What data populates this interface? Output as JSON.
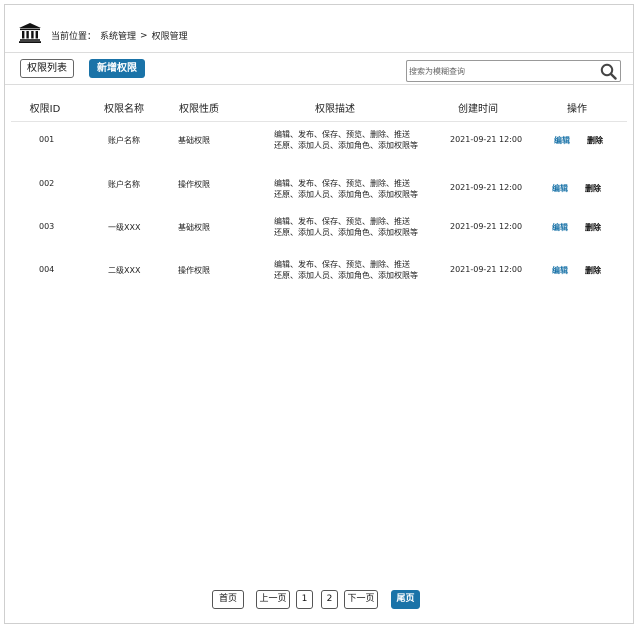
{
  "breadcrumb": {
    "prefix": "当前位置：",
    "section": "系统管理",
    "separator": ">",
    "current": "权限管理"
  },
  "toolbar": {
    "list_tab_label": "权限列表",
    "add_button_label": "新增权限",
    "search_placeholder": "搜索为模糊查询"
  },
  "table": {
    "headers": [
      "权限ID",
      "权限名称",
      "权限性质",
      "权限描述",
      "创建时间",
      "操作"
    ],
    "rows": [
      {
        "id": "001",
        "name": "账户名称",
        "type": "基础权限",
        "desc_line1": "编辑、发布、保存、预览、删除、推送",
        "desc_line2": "还原、添加人员、添加角色、添加权限等",
        "created": "2021-09-21 12:00",
        "edit": "编辑",
        "delete": "删除"
      },
      {
        "id": "002",
        "name": "账户名称",
        "type": "操作权限",
        "desc_line1": "编辑、发布、保存、预览、删除、推送",
        "desc_line2": "还原、添加人员、添加角色、添加权限等",
        "created": "2021-09-21 12:00",
        "edit": "编辑",
        "delete": "删除"
      },
      {
        "id": "003",
        "name": "一级XXX",
        "type": "基础权限",
        "desc_line1": "编辑、发布、保存、预览、删除、推送",
        "desc_line2": "还原、添加人员、添加角色、添加权限等",
        "created": "2021-09-21 12:00",
        "edit": "编辑",
        "delete": "删除"
      },
      {
        "id": "004",
        "name": "二级XXX",
        "type": "操作权限",
        "desc_line1": "编辑、发布、保存、预览、删除、推送",
        "desc_line2": "还原、添加人员、添加角色、添加权限等",
        "created": "2021-09-21 12:00",
        "edit": "编辑",
        "delete": "删除"
      }
    ]
  },
  "pagination": {
    "first": "首页",
    "prev": "上一页",
    "page1": "1",
    "page2": "2",
    "next": "下一页",
    "last": "尾页"
  },
  "icons": {
    "logo": "bank-building-icon",
    "search": "search-icon"
  },
  "colors": {
    "accent": "#1a73a8",
    "border": "#dcdcdc"
  }
}
